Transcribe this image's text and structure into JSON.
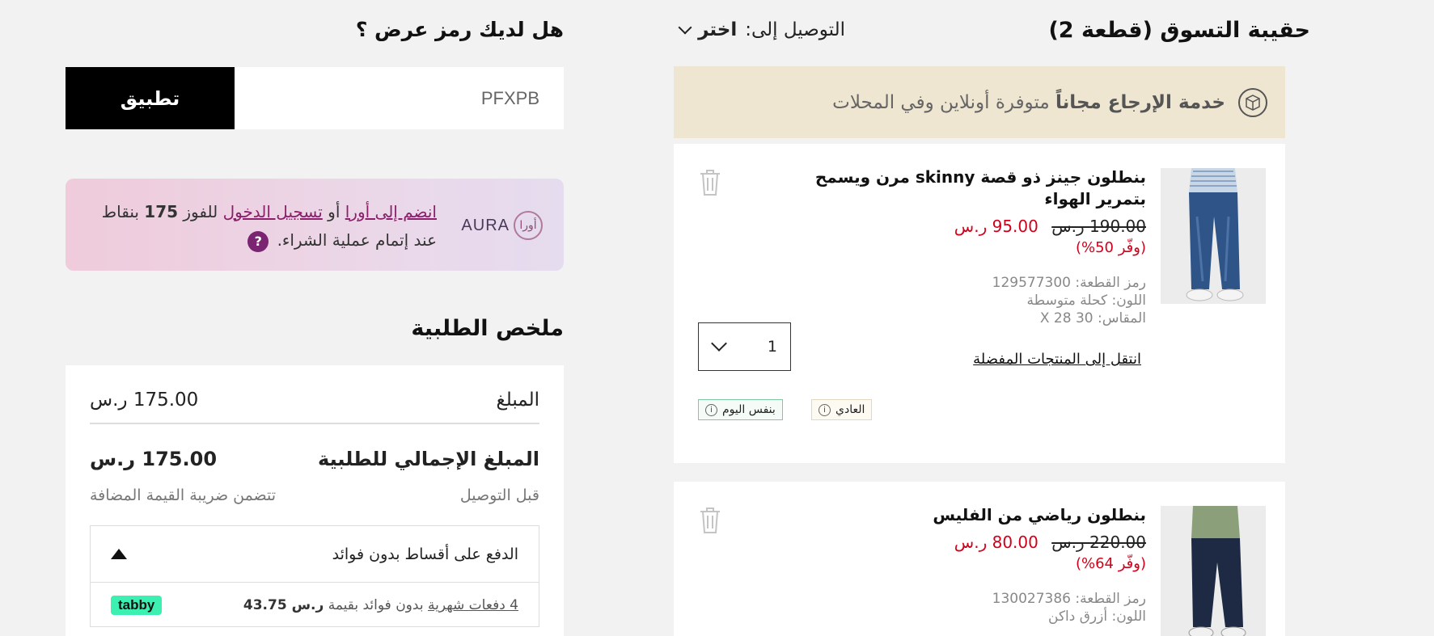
{
  "promo": {
    "title": "هل لديك رمز عرض ؟",
    "input_value": "PFXPB",
    "apply_label": "تطبيق"
  },
  "aura": {
    "logo_text": "AURA",
    "logo_mark": "أورا",
    "join_link": "انضم إلى أورا",
    "or": "أو",
    "login_link": "تسجيل الدخول",
    "text_before_points": "للفوز",
    "points": "175",
    "text_after_points": "بنقاط",
    "line2": "عند إتمام عملية الشراء.",
    "help_icon": "?"
  },
  "summary": {
    "title": "ملخص الطلبية",
    "amount_label": "المبلغ",
    "amount_value": "175.00 ر.س",
    "total_label": "المبلغ الإجمالي للطلبية",
    "total_value": "175.00 ر.س",
    "before_delivery": "قبل التوصيل",
    "vat_note": "تتضمن ضريبة القيمة المضافة",
    "installments_label": "الدفع على أقساط بدون فوائد",
    "tabby_link": "4 دفعات شهرية",
    "tabby_text": "بدون فوائد بقيمة",
    "tabby_amount": "ر.س 43.75",
    "tabby_logo": "tabby"
  },
  "bag": {
    "title": "حقيبة التسوق (قطعة 2)",
    "deliver_label": "التوصيل إلى:",
    "deliver_value": "اختر",
    "return_bold": "خدمة الإرجاع مجاناً",
    "return_text": "متوفرة أونلاين وفي المحلات"
  },
  "items": [
    {
      "name": "بنطلون جينز ذو قصة skinny مرن ويسمح بتمرير الهواء",
      "old_price": "190.00 ر.س",
      "new_price": "95.00 ر.س",
      "save": "(وفّر 50%)",
      "sku": "رمز القطعة: 129577300",
      "color": "اللون: كحلة متوسطة",
      "size": "المقاس: 30 X 28",
      "quantity": "1",
      "fav_link": "انتقل إلى المنتجات المفضلة",
      "ship_standard": "العادي",
      "ship_same_day": "بنفس اليوم"
    },
    {
      "name": "بنطلون رياضي من الفليس",
      "old_price": "220.00 ر.س",
      "new_price": "80.00 ر.س",
      "save": "(وفّر 64%)",
      "sku": "رمز القطعة: 130027386",
      "color": "اللون: أزرق داكن"
    }
  ],
  "colors": {
    "accent_red": "#d0021b",
    "aura_purple": "#8a1f6a",
    "tabby_green": "#3bf0b0",
    "return_banner": "#efe6d2"
  }
}
